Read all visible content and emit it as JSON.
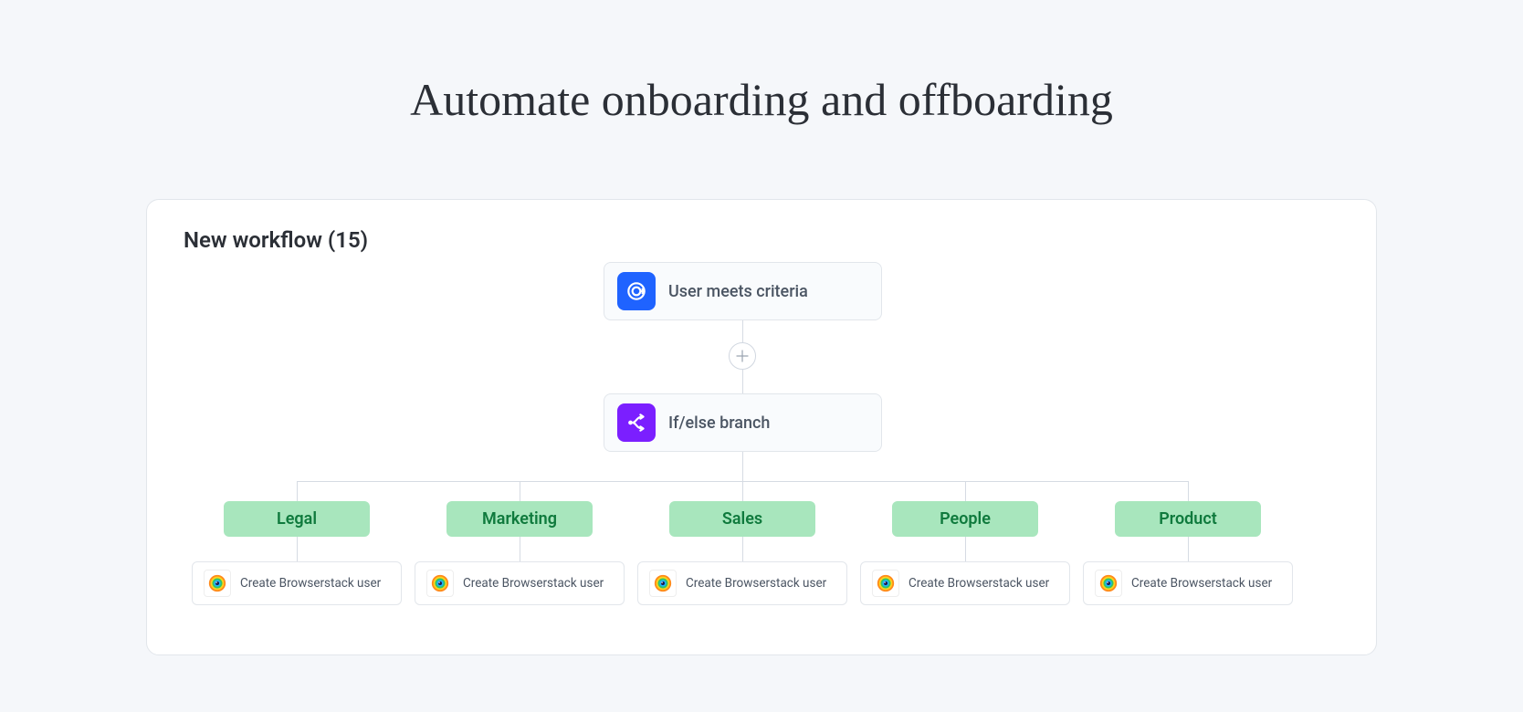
{
  "page": {
    "title": "Automate onboarding and offboarding"
  },
  "workflow": {
    "title": "New workflow (15)",
    "trigger": {
      "label": "User meets criteria"
    },
    "branch_node": {
      "label": "If/else branch"
    },
    "branches": [
      {
        "name": "Legal",
        "action": "Create Browserstack user"
      },
      {
        "name": "Marketing",
        "action": "Create Browserstack user"
      },
      {
        "name": "Sales",
        "action": "Create Browserstack user"
      },
      {
        "name": "People",
        "action": "Create Browserstack user"
      },
      {
        "name": "Product",
        "action": "Create Browserstack user"
      }
    ]
  }
}
